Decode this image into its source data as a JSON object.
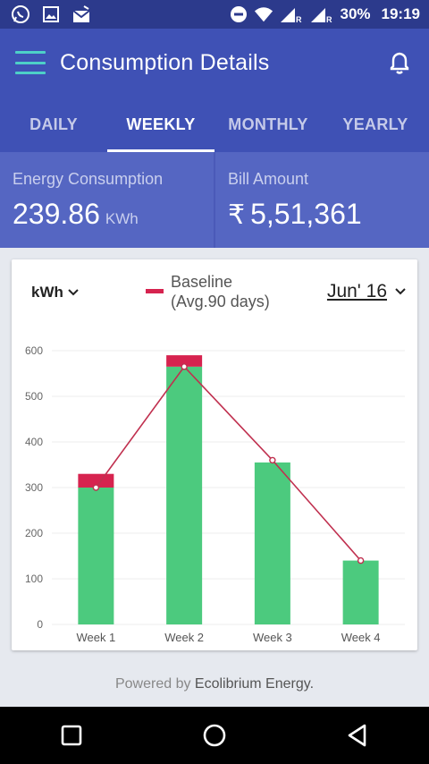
{
  "status_bar": {
    "icons_left": [
      "whatsapp-icon",
      "image-icon",
      "mail-icon"
    ],
    "icons_right": [
      "do-not-disturb-icon",
      "wifi-icon",
      "signal-icon",
      "signal-icon"
    ],
    "roaming_1": "R",
    "roaming_2": "R",
    "battery": "30%",
    "time": "19:19"
  },
  "header": {
    "title": "Consumption Details",
    "menu_icon": "hamburger-icon",
    "notification_icon": "bell-icon"
  },
  "tabs": [
    {
      "label": "DAILY",
      "active": false
    },
    {
      "label": "WEEKLY",
      "active": true
    },
    {
      "label": "MONTHLY",
      "active": false
    },
    {
      "label": "YEARLY",
      "active": false
    }
  ],
  "summary": {
    "energy": {
      "label": "Energy Consumption",
      "value": "239.86",
      "unit": "KWh"
    },
    "bill": {
      "label": "Bill Amount",
      "currency": "₹",
      "value": "5,51,361"
    }
  },
  "card": {
    "unit_select": "kWh",
    "legend_line1": "Baseline",
    "legend_line2": "(Avg.90 days)",
    "period": "Jun' 16"
  },
  "chart_data": {
    "type": "bar",
    "categories": [
      "Week 1",
      "Week 2",
      "Week 3",
      "Week 4"
    ],
    "series": [
      {
        "values": [
          330,
          590,
          355,
          140
        ],
        "color": "#4cca7e"
      },
      {
        "name": "Baseline (Avg.90 days)",
        "type": "line",
        "values": [
          300,
          565,
          360,
          140
        ],
        "color": "#c0304f"
      }
    ],
    "yticks": [
      0,
      100,
      200,
      300,
      400,
      500,
      600
    ],
    "ylim": [
      0,
      600
    ],
    "excess_color": "#d6234f",
    "grid": true
  },
  "footer": {
    "powered_prefix": "Powered by",
    "powered_brand": "Ecolibrium Energy."
  },
  "nav": {
    "recent": "recent-apps-icon",
    "home": "home-icon",
    "back": "back-icon"
  }
}
